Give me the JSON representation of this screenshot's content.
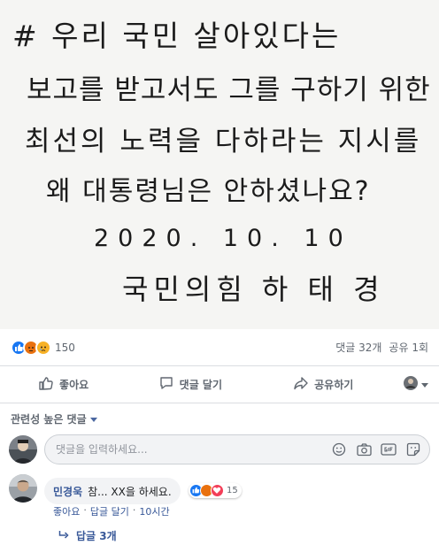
{
  "post": {
    "photo_lines": [
      "# 우리 국민 살아있다는",
      "보고를 받고서도 그를 구하기 위한",
      "최선의 노력을 다하라는 지시를",
      "왜 대통령님은 안하셨나요?",
      "2020. 10. 10",
      "국민의힘 하 태 경"
    ]
  },
  "reactions": {
    "count": "150",
    "comments": "댓글 32개",
    "shares": "공유 1회",
    "icons": [
      "like-icon",
      "angry-icon",
      "sad-icon"
    ],
    "colors": {
      "like": "#1877f2",
      "angry": "#e9710f",
      "sad": "#f7b125"
    }
  },
  "actions": {
    "like_label": "좋아요",
    "comment_label": "댓글 달기",
    "share_label": "공유하기"
  },
  "comments_section": {
    "sort_label": "관련성 높은 댓글",
    "input_placeholder": "댓글을 입력하세요...",
    "composer_icons": [
      "emoji-icon",
      "camera-icon",
      "gif-icon",
      "sticker-icon"
    ]
  },
  "comment": {
    "author": "민경욱",
    "text": "참... XX을 하세요.",
    "reaction_count": "15",
    "reaction_icons": [
      "like-icon",
      "angry-icon",
      "love-icon"
    ],
    "like_label": "좋아요",
    "separator": "·",
    "reply_label": "답글 달기",
    "time": "10시간",
    "replies_label": "답글 3개"
  },
  "colors": {
    "link": "#385898",
    "muted": "#606770",
    "border": "#dadde1"
  }
}
